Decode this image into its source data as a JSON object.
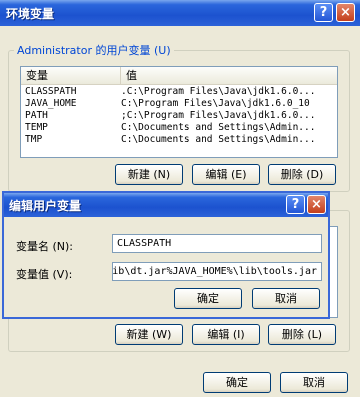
{
  "window": {
    "title": "环境变量",
    "help": "?",
    "close": "×"
  },
  "user_vars": {
    "group_label": "Administrator 的用户变量 (U)",
    "columns": [
      "变量",
      "值"
    ],
    "rows": [
      {
        "name": "CLASSPATH",
        "value": ".C:\\Program Files\\Java\\jdk1.6.0..."
      },
      {
        "name": "JAVA_HOME",
        "value": "C:\\Program Files\\Java\\jdk1.6.0_10"
      },
      {
        "name": "PATH",
        "value": ";C:\\Program Files\\Java\\jdk1.6.0..."
      },
      {
        "name": "TEMP",
        "value": "C:\\Documents and Settings\\Admin..."
      },
      {
        "name": "TMP",
        "value": "C:\\Documents and Settings\\Admin..."
      }
    ],
    "new_label": "新建 (N)",
    "edit_label": "编辑 (E)",
    "delete_label": "删除 (D)"
  },
  "system_vars": {
    "new_label": "新建 (W)",
    "edit_label": "编辑 (I)",
    "delete_label": "删除 (L)"
  },
  "footer": {
    "ok_label": "确定",
    "cancel_label": "取消"
  },
  "edit_dialog": {
    "title": "编辑用户变量",
    "help": "?",
    "close": "×",
    "name_label": "变量名 (N):",
    "name_value": "CLASSPATH",
    "value_label": "变量值 (V):",
    "value_value": ".lib\\dt.jar%JAVA_HOME%\\lib\\tools.jar",
    "ok_label": "确定",
    "cancel_label": "取消"
  }
}
